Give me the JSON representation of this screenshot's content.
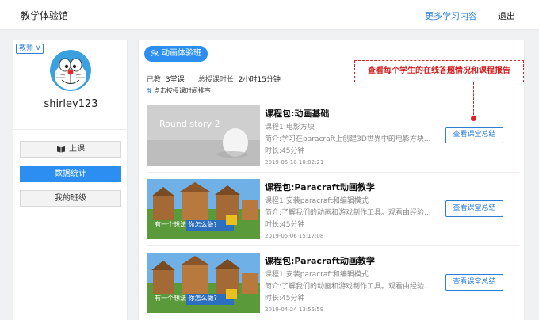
{
  "header": {
    "title": "教学体验馆",
    "more_link": "更多学习内容",
    "logout": "退出"
  },
  "sidebar": {
    "role": "教师 ∨",
    "username": "shirley123",
    "buttons": {
      "class": "上课",
      "stats": "数据统计",
      "my_class": "我的班级"
    }
  },
  "main": {
    "tab_label": "动画体验班",
    "stats": {
      "taught_label": "已教:",
      "taught_value": "3堂课",
      "duration_label": "总授课时长:",
      "duration_value": "2小时15分钟"
    },
    "sort_label": "点击按授课时间排序",
    "callout": "查看每个学生的在线答题情况和课程报告",
    "summary_label": "查看课堂总结",
    "courses": [
      {
        "title": "课程包:动画基础",
        "lesson": "课程1:电影方块",
        "desc": "简介:学习在paracraft上创建3D世界中的电影方块...",
        "time": "时长:45分钟",
        "date": "2019-05-10 10:02:21",
        "thumb_text": "Round story 2"
      },
      {
        "title": "课程包:Paracraft动画教学",
        "lesson": "课程1:安装paracraft和编辑模式",
        "desc": "简介:了解我们的动画和游戏制作工具。观看由经验...",
        "time": "时长:45分钟",
        "date": "2019-05-06 15:17:08",
        "thumb_text": "有一个想法 你怎么做?"
      },
      {
        "title": "课程包:Paracraft动画教学",
        "lesson": "课程1:安装paracraft和编辑模式",
        "desc": "简介:了解我们的动画和游戏制作工具。观看由经验...",
        "time": "时长:45分钟",
        "date": "2019-04-24 13:55:59",
        "thumb_text": "有一个想法 你怎么做?"
      }
    ]
  }
}
